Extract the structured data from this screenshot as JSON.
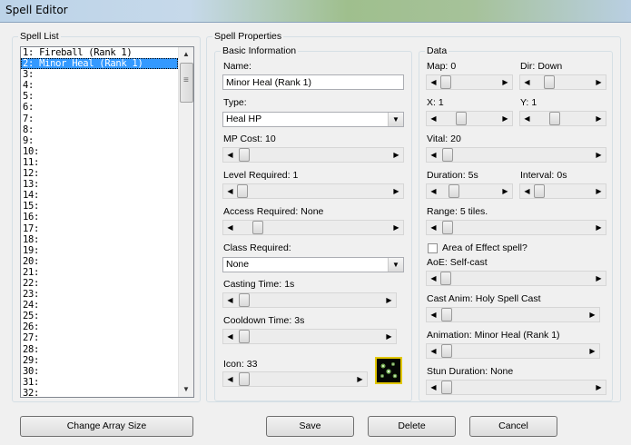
{
  "window": {
    "title": "Spell Editor"
  },
  "spell_list": {
    "legend": "Spell List",
    "items": [
      "1: Fireball (Rank 1)",
      "2: Minor Heal (Rank 1)",
      "3:",
      "4:",
      "5:",
      "6:",
      "7:",
      "8:",
      "9:",
      "10:",
      "11:",
      "12:",
      "13:",
      "14:",
      "15:",
      "16:",
      "17:",
      "18:",
      "19:",
      "20:",
      "21:",
      "22:",
      "23:",
      "24:",
      "25:",
      "26:",
      "27:",
      "28:",
      "29:",
      "30:",
      "31:",
      "32:"
    ],
    "selected_index": 1
  },
  "spell_properties": {
    "legend": "Spell Properties",
    "basic": {
      "legend": "Basic Information",
      "name_label": "Name:",
      "name_value": "Minor Heal (Rank 1)",
      "type_label": "Type:",
      "type_value": "Heal HP",
      "mp_cost_label": "MP Cost:",
      "mp_cost_value": "10",
      "level_req_label": "Level Required:",
      "level_req_value": "1",
      "access_req_label": "Access Required:",
      "access_req_value": "None",
      "class_req_label": "Class Required:",
      "class_req_value": "None",
      "casting_time_label": "Casting Time:",
      "casting_time_value": "1s",
      "cooldown_label": "Cooldown Time:",
      "cooldown_value": "3s",
      "icon_label": "Icon:",
      "icon_value": "33"
    },
    "data": {
      "legend": "Data",
      "map_label": "Map:",
      "map_value": "0",
      "dir_label": "Dir:",
      "dir_value": "Down",
      "x_label": "X:",
      "x_value": "1",
      "y_label": "Y:",
      "y_value": "1",
      "vital_label": "Vital:",
      "vital_value": "20",
      "duration_label": "Duration:",
      "duration_value": "5s",
      "interval_label": "Interval:",
      "interval_value": "0s",
      "range_label": "Range:",
      "range_value": "5 tiles.",
      "aoe_checkbox_label": "Area of Effect spell?",
      "aoe_checked": false,
      "aoe_label": "AoE:",
      "aoe_value": "Self-cast",
      "cast_anim_label": "Cast Anim:",
      "cast_anim_value": "Holy Spell Cast",
      "animation_label": "Animation:",
      "animation_value": "Minor Heal (Rank 1)",
      "stun_label": "Stun Duration:",
      "stun_value": "None"
    }
  },
  "buttons": {
    "change_array_size": "Change Array Size",
    "save": "Save",
    "delete": "Delete",
    "cancel": "Cancel"
  },
  "icons": {
    "list_scroll_up": "▲",
    "list_scroll_down": "▼",
    "scroll_left": "◀",
    "scroll_right": "▶",
    "dropdown": "▼"
  }
}
